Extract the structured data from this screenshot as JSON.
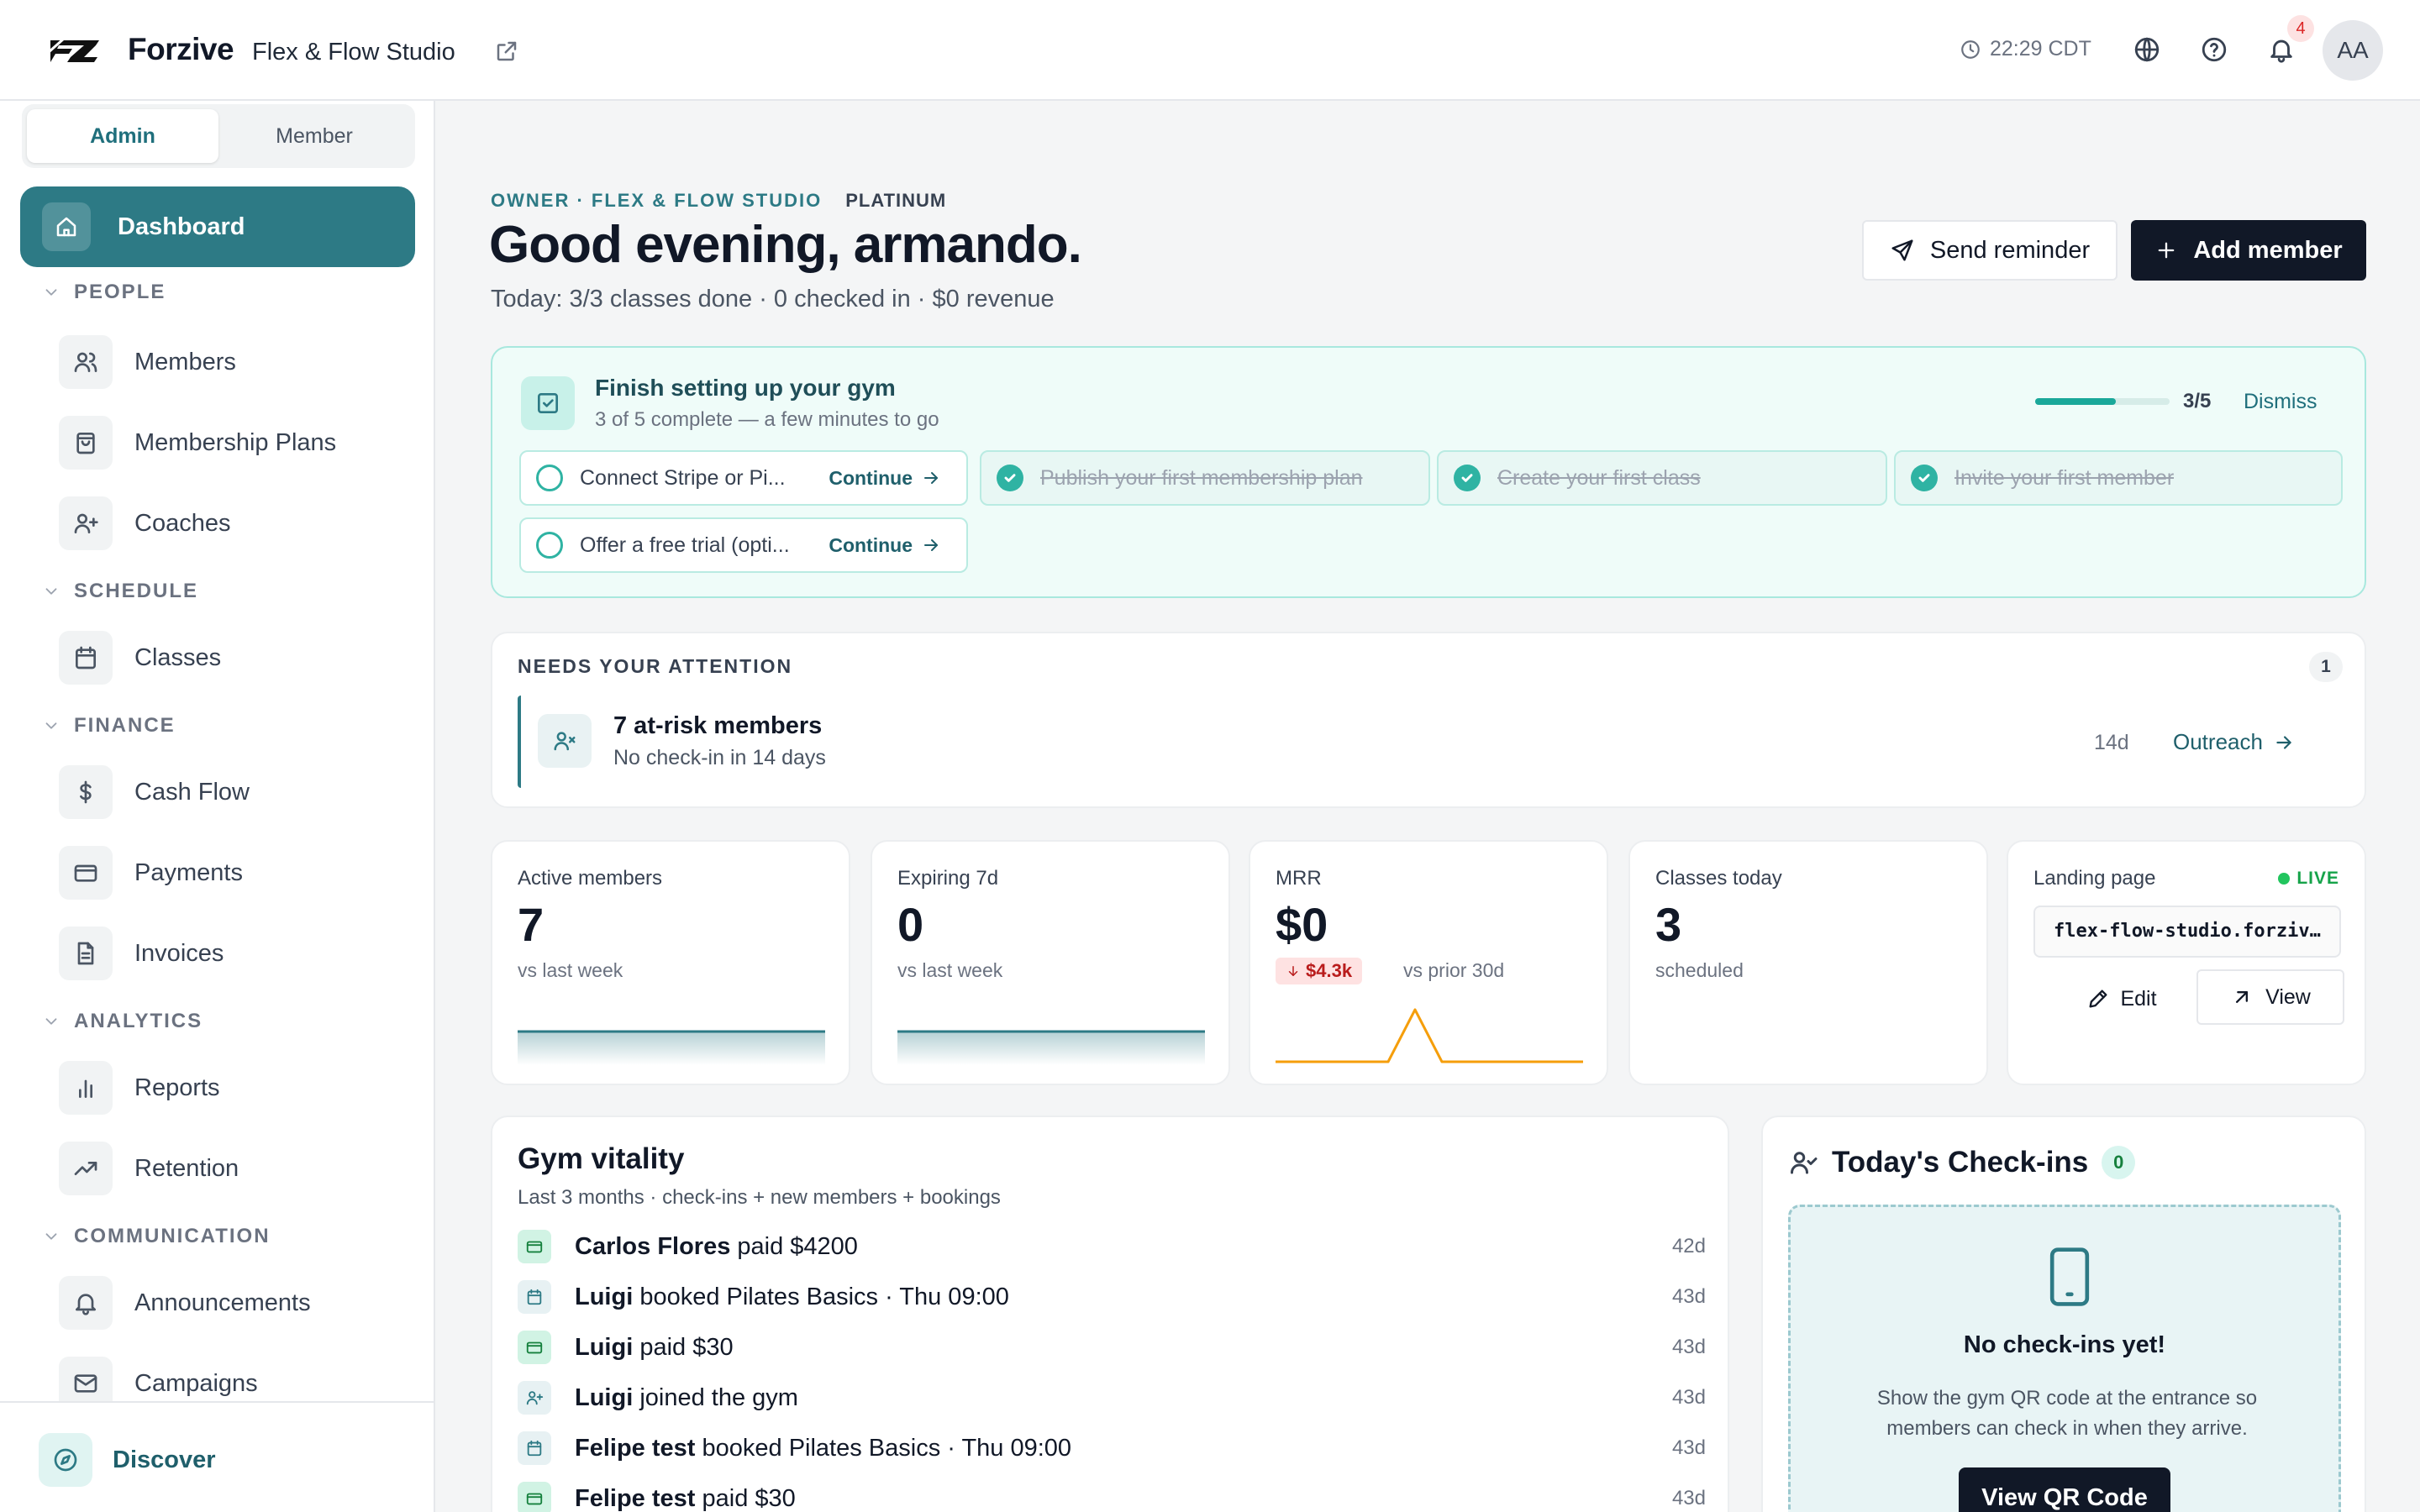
{
  "topbar": {
    "brand": "Forzive",
    "studio": "Flex & Flow Studio",
    "time": "22:29 CDT",
    "notification_count": "4",
    "avatar_initials": "AA",
    "icons": [
      "logo-mark",
      "external-link-icon",
      "clock-icon",
      "globe-icon",
      "help-circle-icon",
      "bell-icon"
    ]
  },
  "sidebar": {
    "role_toggle": {
      "admin": "Admin",
      "member": "Member",
      "selected": "Admin"
    },
    "dashboard": "Dashboard",
    "sections": {
      "people": "PEOPLE",
      "schedule": "SCHEDULE",
      "finance": "FINANCE",
      "analytics": "ANALYTICS",
      "communication": "COMMUNICATION"
    },
    "items": {
      "members": "Members",
      "membership_plans": "Membership Plans",
      "coaches": "Coaches",
      "classes": "Classes",
      "cash_flow": "Cash Flow",
      "payments": "Payments",
      "invoices": "Invoices",
      "reports": "Reports",
      "retention": "Retention",
      "announcements": "Announcements",
      "campaigns": "Campaigns"
    },
    "discover": "Discover"
  },
  "header": {
    "owner_label": "OWNER · FLEX & FLOW STUDIO",
    "tier": "PLATINUM",
    "greeting": "Good evening, armando.",
    "summary": "Today: 3/3 classes done · 0 checked in · $0 revenue",
    "send_reminder": "Send reminder",
    "add_member": "Add member"
  },
  "setup": {
    "title": "Finish setting up your gym",
    "subtitle": "3 of 5 complete — a few minutes to go",
    "progress": 0.6,
    "progress_text": "3/5",
    "dismiss": "Dismiss",
    "continue_label": "Continue",
    "tasks": [
      {
        "label": "Connect Stripe or Pi...",
        "done": false
      },
      {
        "label": "Publish your first membership plan",
        "done": true
      },
      {
        "label": "Create your first class",
        "done": true
      },
      {
        "label": "Invite your first member",
        "done": true
      },
      {
        "label": "Offer a free trial (opti...",
        "done": false
      }
    ]
  },
  "attention": {
    "heading": "NEEDS YOUR ATTENTION",
    "count": "1",
    "item_title": "7 at-risk members",
    "item_sub": "No check-in in 14 days",
    "age": "14d",
    "action": "Outreach"
  },
  "stats": {
    "active": {
      "label": "Active members",
      "value": "7",
      "sub": "vs last week"
    },
    "expiring": {
      "label": "Expiring 7d",
      "value": "0",
      "sub": "vs last week"
    },
    "mrr": {
      "label": "MRR",
      "value": "$0",
      "delta": "$4.3k",
      "delta_direction": "down",
      "sub": "vs prior 30d"
    },
    "classes": {
      "label": "Classes today",
      "value": "3",
      "sub": "scheduled"
    },
    "landing": {
      "label": "Landing page",
      "status": "LIVE",
      "url": "flex-flow-studio.forzive.com",
      "edit": "Edit",
      "view": "View"
    }
  },
  "vitality": {
    "title": "Gym vitality",
    "subtitle": "Last 3 months · check-ins + new members + bookings",
    "feed": [
      {
        "kind": "pay",
        "name": "Carlos Flores",
        "text": " paid $4200",
        "age": "42d"
      },
      {
        "kind": "book",
        "name": "Luigi",
        "text": " booked Pilates Basics · Thu 09:00",
        "age": "43d"
      },
      {
        "kind": "pay",
        "name": "Luigi",
        "text": " paid $30",
        "age": "43d"
      },
      {
        "kind": "join",
        "name": "Luigi",
        "text": " joined the gym",
        "age": "43d"
      },
      {
        "kind": "book",
        "name": "Felipe test",
        "text": " booked Pilates Basics · Thu 09:00",
        "age": "43d"
      },
      {
        "kind": "pay",
        "name": "Felipe test",
        "text": " paid $30",
        "age": "43d"
      }
    ]
  },
  "checkins": {
    "title": "Today's Check-ins",
    "count": "0",
    "empty_title": "No check-ins yet!",
    "empty_text": "Show the gym QR code at the entrance so members can check in when they arrive.",
    "button": "View QR Code"
  },
  "colors": {
    "accent": "#2d7a85",
    "setup_bg": "#effcf9",
    "primary_button": "#111827",
    "mrr_spark": "#f59e0b",
    "delta_negative": "#b91c1c",
    "live": "#16a34a"
  }
}
